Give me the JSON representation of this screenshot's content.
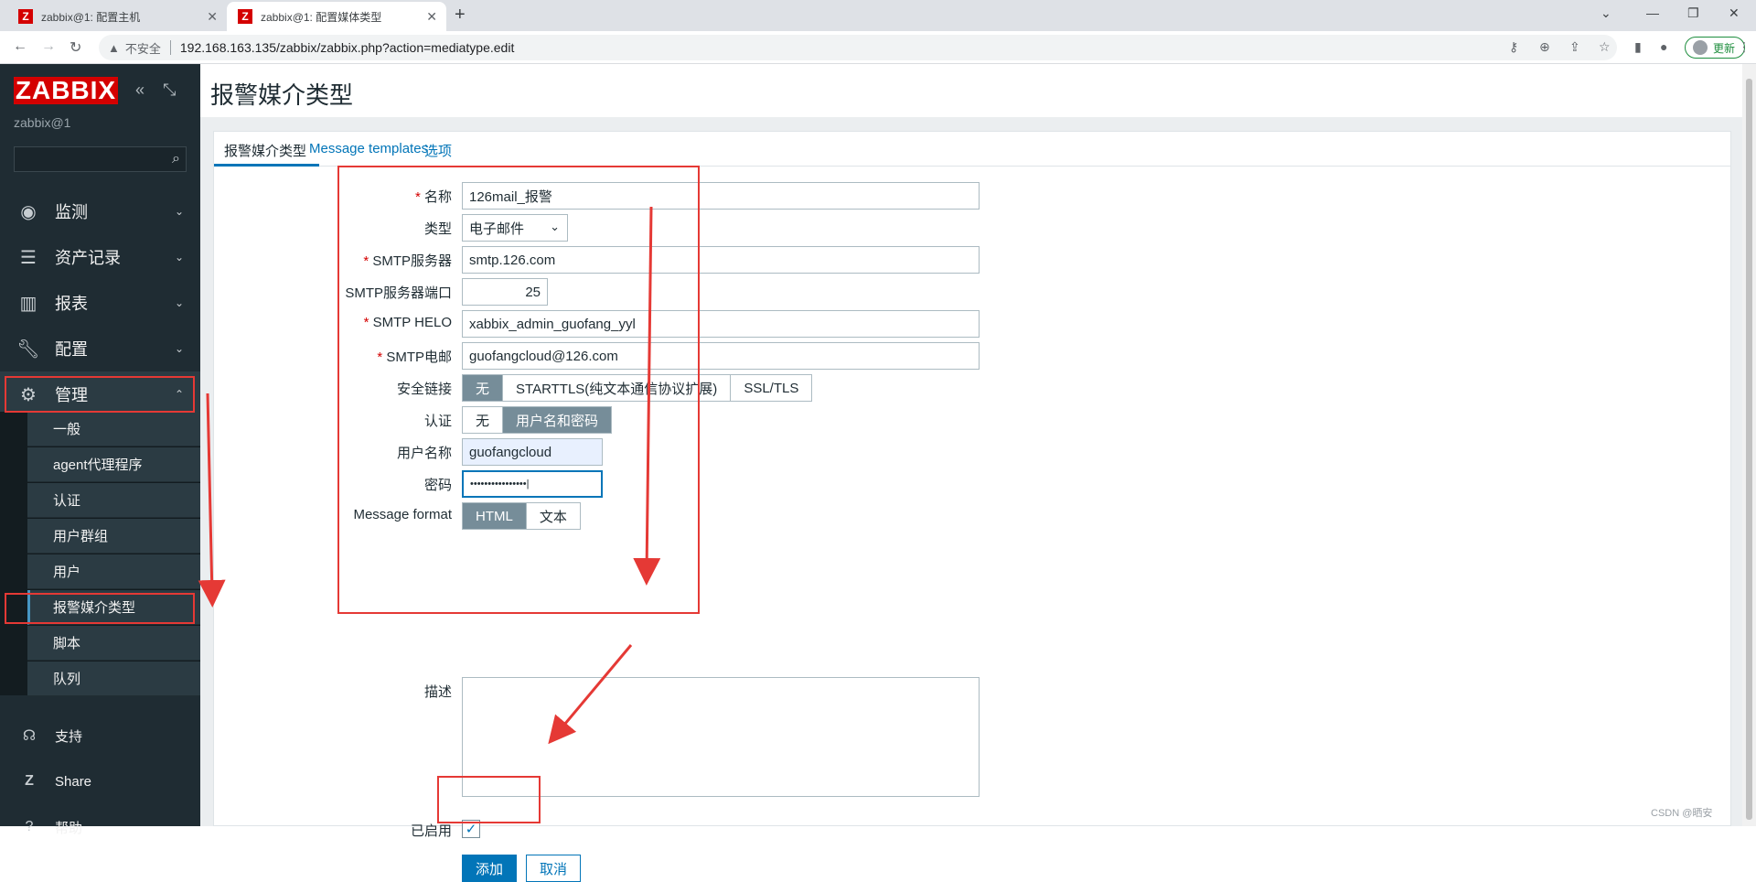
{
  "browser": {
    "tabs": [
      {
        "title": "zabbix@1: 配置主机",
        "active": false
      },
      {
        "title": "zabbix@1: 配置媒体类型",
        "active": true
      }
    ],
    "security_label": "不安全",
    "url": "192.168.163.135/zabbix/zabbix.php?action=mediatype.edit",
    "update_label": "更新"
  },
  "sidebar": {
    "logo": "ZABBIX",
    "server_name": "zabbix@1",
    "search_placeholder": "",
    "menu": [
      {
        "label": "监测",
        "icon": "eye-icon"
      },
      {
        "label": "资产记录",
        "icon": "list-icon"
      },
      {
        "label": "报表",
        "icon": "bar-chart-icon"
      },
      {
        "label": "配置",
        "icon": "wrench-icon"
      },
      {
        "label": "管理",
        "icon": "gear-icon",
        "open": true
      }
    ],
    "submenu": [
      {
        "label": "一般"
      },
      {
        "label": "agent代理程序"
      },
      {
        "label": "认证"
      },
      {
        "label": "用户群组"
      },
      {
        "label": "用户"
      },
      {
        "label": "报警媒介类型",
        "active": true
      },
      {
        "label": "脚本"
      },
      {
        "label": "队列"
      }
    ],
    "bottom": [
      {
        "label": "支持",
        "icon": "headset-icon"
      },
      {
        "label": "Share",
        "icon": "zabbix-share-icon"
      },
      {
        "label": "帮助",
        "icon": "help-icon"
      }
    ]
  },
  "page": {
    "title": "报警媒介类型",
    "tabs": [
      "报警媒介类型",
      "Message templates",
      "选项"
    ]
  },
  "form": {
    "name_label": "名称",
    "name_value": "126mail_报警",
    "type_label": "类型",
    "type_value": "电子邮件",
    "smtp_server_label": "SMTP服务器",
    "smtp_server_value": "smtp.126.com",
    "smtp_port_label": "SMTP服务器端口",
    "smtp_port_value": "25",
    "smtp_helo_label": "SMTP HELO",
    "smtp_helo_value": "xabbix_admin_guofang_yyl",
    "smtp_email_label": "SMTP电邮",
    "smtp_email_value": "guofangcloud@126.com",
    "security_label": "安全链接",
    "security_options": [
      "无",
      "STARTTLS(纯文本通信协议扩展)",
      "SSL/TLS"
    ],
    "security_selected": "无",
    "auth_label": "认证",
    "auth_options": [
      "无",
      "用户名和密码"
    ],
    "auth_selected": "用户名和密码",
    "username_label": "用户名称",
    "username_value": "guofangcloud",
    "password_label": "密码",
    "password_value": "••••••••••••••••|",
    "format_label": "Message format",
    "format_options": [
      "HTML",
      "文本"
    ],
    "format_selected": "HTML",
    "description_label": "描述",
    "description_value": "",
    "enabled_label": "已启用",
    "enabled": true,
    "add_label": "添加",
    "cancel_label": "取消"
  },
  "watermark": "CSDN @晒安",
  "colors": {
    "sidebar_bg": "#1f2c33",
    "brand_red": "#d40000",
    "link_blue": "#0275b8",
    "annotation_red": "#e53935"
  }
}
